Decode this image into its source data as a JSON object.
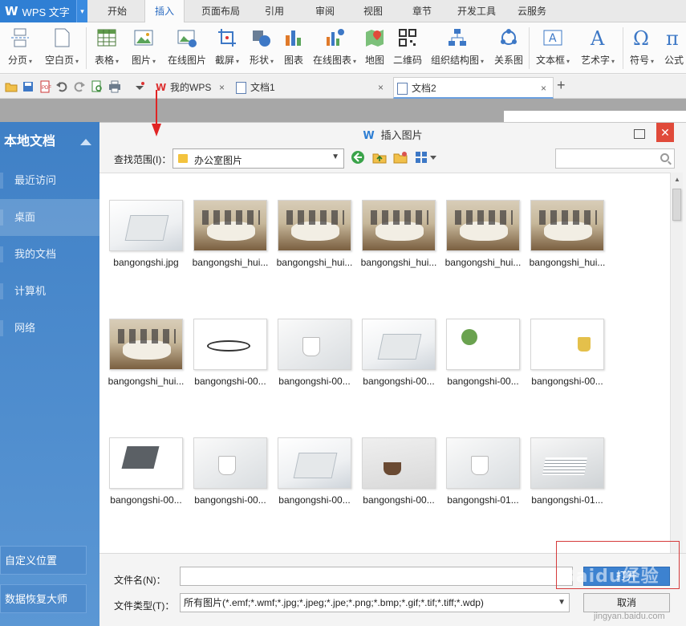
{
  "app": {
    "logo": "W",
    "name": "WPS 文字",
    "menu_arrow": "▾"
  },
  "menu_tabs": [
    "开始",
    "插入",
    "页面布局",
    "引用",
    "审阅",
    "视图",
    "章节",
    "开发工具",
    "云服务"
  ],
  "active_menu_tab": "插入",
  "ribbon": [
    {
      "label": "分页",
      "dropdown": true,
      "icon": "page-break-icon"
    },
    {
      "label": "空白页",
      "dropdown": true,
      "icon": "blank-page-icon"
    },
    {
      "label": "表格",
      "dropdown": true,
      "icon": "table-icon"
    },
    {
      "label": "图片",
      "dropdown": true,
      "icon": "picture-icon"
    },
    {
      "label": "在线图片",
      "dropdown": false,
      "icon": "online-picture-icon"
    },
    {
      "label": "截屏",
      "dropdown": true,
      "icon": "screenshot-icon"
    },
    {
      "label": "形状",
      "dropdown": true,
      "icon": "shapes-icon"
    },
    {
      "label": "图表",
      "dropdown": false,
      "icon": "chart-icon"
    },
    {
      "label": "在线图表",
      "dropdown": true,
      "icon": "online-chart-icon"
    },
    {
      "label": "地图",
      "dropdown": false,
      "icon": "map-icon"
    },
    {
      "label": "二维码",
      "dropdown": false,
      "icon": "qrcode-icon"
    },
    {
      "label": "组织结构图",
      "dropdown": true,
      "icon": "org-chart-icon"
    },
    {
      "label": "关系图",
      "dropdown": false,
      "icon": "relation-chart-icon"
    },
    {
      "label": "文本框",
      "dropdown": true,
      "icon": "textbox-icon"
    },
    {
      "label": "艺术字",
      "dropdown": true,
      "icon": "wordart-icon"
    },
    {
      "label": "符号",
      "dropdown": true,
      "icon": "symbol-icon"
    },
    {
      "label": "公式",
      "dropdown": false,
      "icon": "formula-icon"
    }
  ],
  "ribbon_glyphs": {
    "wordart": "A",
    "symbol": "Ω",
    "formula": "π"
  },
  "doc_tabs": [
    {
      "label": "我的WPS",
      "close": "×"
    },
    {
      "label": "文档1",
      "close": "×"
    },
    {
      "label": "文档2",
      "close": "×"
    }
  ],
  "new_tab": "+",
  "dialog": {
    "title": "插入图片",
    "title_logo": "W",
    "close": "✕",
    "lookin_label": "查找范围(I)：",
    "lookin_value": "办公室图片",
    "search_placeholder": "",
    "sidebar_header": "本地文档",
    "sidebar_items": [
      "最近访问",
      "桌面",
      "我的文档",
      "计算机",
      "网络"
    ],
    "sidebar_active": "桌面",
    "sidebar_bottom": [
      "自定义位置",
      "数据恢复大师"
    ],
    "files": [
      {
        "name": "bangongshi.jpg",
        "thumb": "desk"
      },
      {
        "name": "bangongshi_hui...",
        "thumb": "meet"
      },
      {
        "name": "bangongshi_hui...",
        "thumb": "meet"
      },
      {
        "name": "bangongshi_hui...",
        "thumb": "meet"
      },
      {
        "name": "bangongshi_hui...",
        "thumb": "meet"
      },
      {
        "name": "bangongshi_hui...",
        "thumb": "meet"
      },
      {
        "name": "bangongshi_hui...",
        "thumb": "meet"
      },
      {
        "name": "bangongshi-00...",
        "thumb": "glass"
      },
      {
        "name": "bangongshi-00...",
        "thumb": "white"
      },
      {
        "name": "bangongshi-00...",
        "thumb": "desk"
      },
      {
        "name": "bangongshi-00...",
        "thumb": "plant"
      },
      {
        "name": "bangongshi-00...",
        "thumb": "cup"
      },
      {
        "name": "bangongshi-00...",
        "thumb": "lap"
      },
      {
        "name": "bangongshi-00...",
        "thumb": "white"
      },
      {
        "name": "bangongshi-00...",
        "thumb": "desk"
      },
      {
        "name": "bangongshi-00...",
        "thumb": "dark"
      },
      {
        "name": "bangongshi-01...",
        "thumb": "white"
      },
      {
        "name": "bangongshi-01...",
        "thumb": "books"
      }
    ],
    "filename_label": "文件名(N)：",
    "filename_value": "",
    "filetype_label": "文件类型(T)：",
    "filetype_value": "所有图片(*.emf;*.wmf;*.jpg;*.jpeg;*.jpe;*.png;*.bmp;*.gif;*.tif;*.tiff;*.wdp)",
    "open_label": "打开",
    "cancel_label": "取消"
  },
  "watermark": {
    "main": "Baidu经验",
    "sub": "jingyan.baidu.com"
  },
  "colors": {
    "accent": "#2f7fd4",
    "sidebar": "#4a88cc",
    "close": "#e04a3a",
    "annotation": "#e02424"
  }
}
